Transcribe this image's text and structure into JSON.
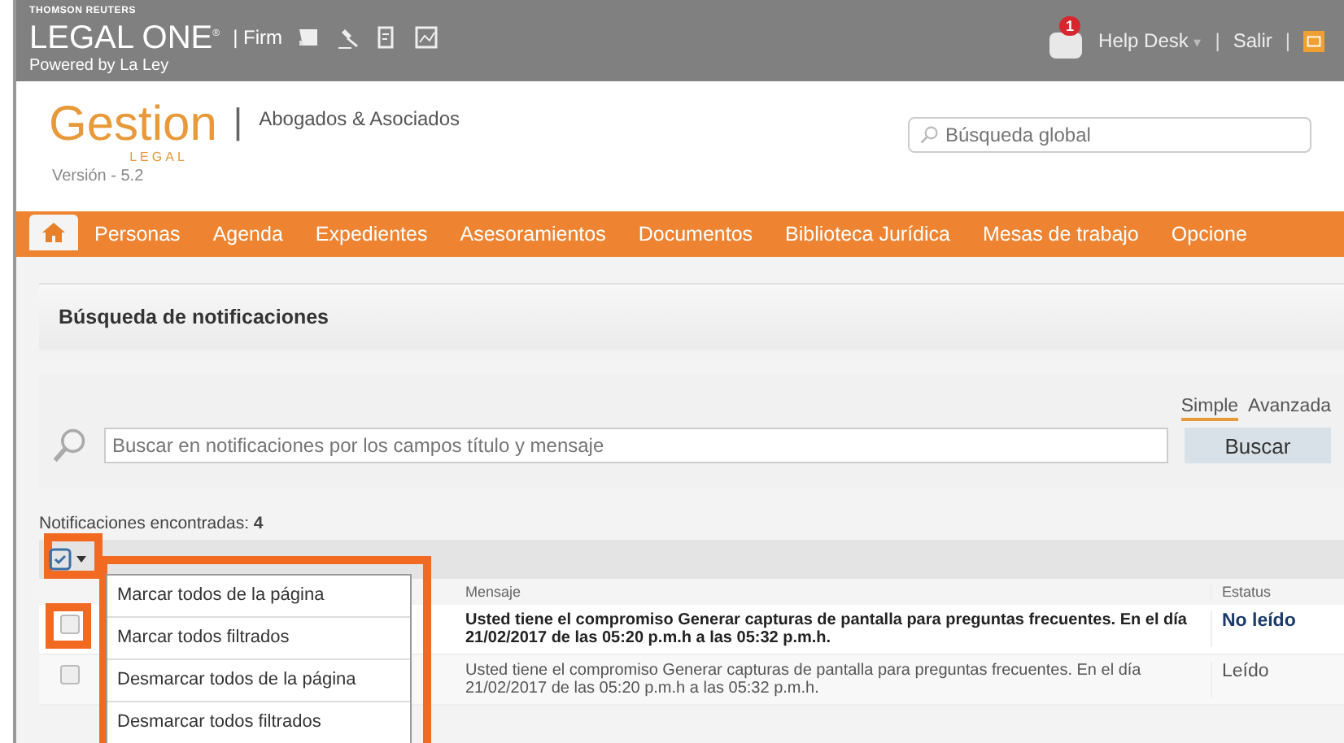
{
  "header": {
    "company": "THOMSON REUTERS",
    "product": "LEGAL ONE",
    "product_mark": "®",
    "edition": "| Firm",
    "separator": "|",
    "powered_by": "Powered by La Ley",
    "notifications": "1",
    "help_desk": "Help Desk",
    "help_caret": "▾",
    "logout": "Salir"
  },
  "brand": {
    "name": "Gestion",
    "sub": "LEGAL",
    "separator": "|",
    "firm": "Abogados & Asociados",
    "version": "Versión - 5.2"
  },
  "global_search": {
    "placeholder": "Búsqueda global"
  },
  "nav": [
    "Personas",
    "Agenda",
    "Expedientes",
    "Asesoramientos",
    "Documentos",
    "Biblioteca Jurídica",
    "Mesas de trabajo",
    "Opcione"
  ],
  "panel": {
    "title": "Búsqueda de notificaciones"
  },
  "search": {
    "modes": [
      {
        "label": "Simple",
        "selected": true
      },
      {
        "label": "Avanzada",
        "selected": false
      }
    ],
    "placeholder": "Buscar en notificaciones por los campos título y mensaje",
    "button": "Buscar"
  },
  "results_count": "Notificaciones encontradas: **4**",
  "select_menu": {
    "items": [
      "Marcar todos de la página",
      "Marcar todos filtrados",
      "Desmarcar todos de la página",
      "Desmarcar todos filtrados"
    ]
  },
  "table": {
    "columns": [
      "Mensaje",
      "Estatus"
    ],
    "rows": [
      {
        "checked": false,
        "read": false,
        "message": "Usted tiene el compromiso Generar capturas de pantalla para preguntas frecuentes. En el día 21/02/2017 de las 05:20 p.m.h a las 05:32 p.m.h.",
        "status": "No leído"
      },
      {
        "checked": false,
        "read": true,
        "message": "Usted tiene el compromiso Generar capturas de pantalla para preguntas frecuentes. En el día 21/02/2017 de las 05:20 p.m.h a las 05:32 p.m.h.",
        "status": "Leído"
      }
    ]
  }
}
